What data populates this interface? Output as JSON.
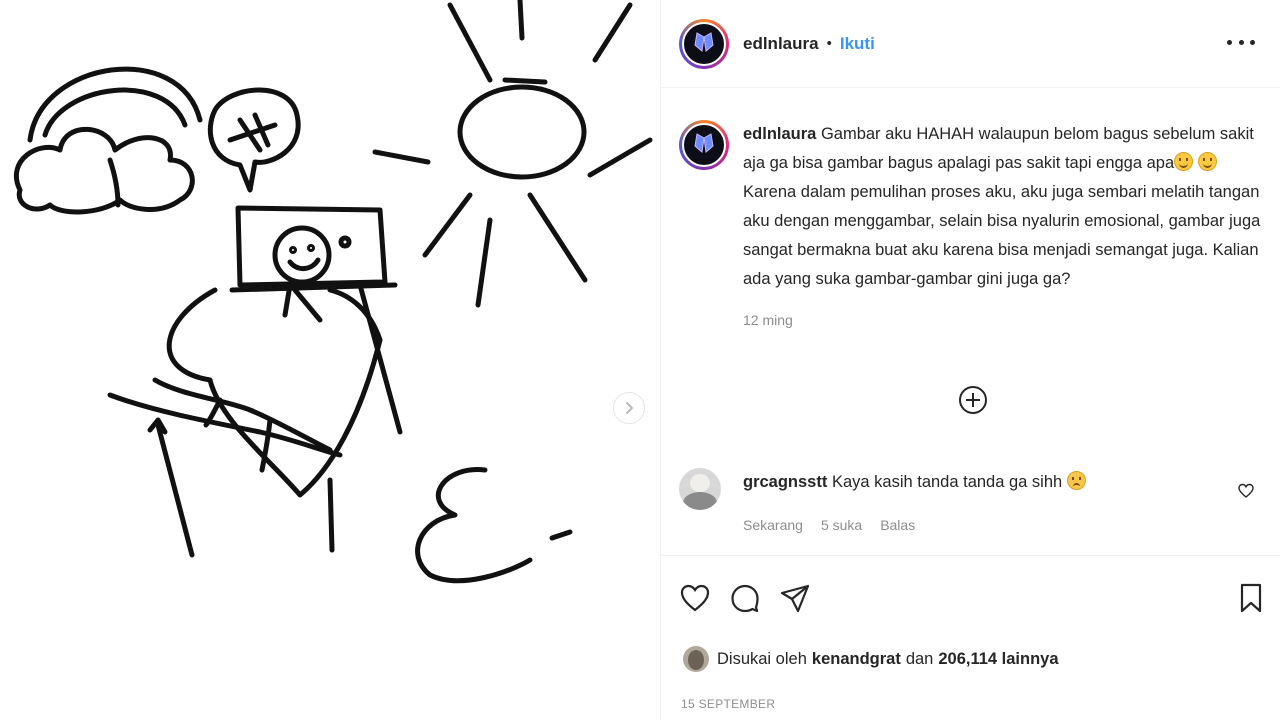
{
  "post": {
    "author": "edlnlaura",
    "separator": "•",
    "follow_label": "Ikuti",
    "more_options_icon": "more-horizontal-icon"
  },
  "caption": {
    "author": "edlnlaura",
    "text_part1": "Gambar aku HAHAH walaupun belom bagus sebelum sakit aja ga bisa gambar bagus apalagi pas sakit tapi engga apa",
    "text_part2": "Karena dalam pemulihan proses aku, aku juga sembari melatih tangan aku dengan menggambar, selain bisa nyalurin emosional, gambar juga sangat bermakna buat aku karena bisa menjadi semangat juga. Kalian ada yang suka gambar-gambar gini juga ga?",
    "time": "12 ming"
  },
  "load_more_icon": "plus-circle-icon",
  "comments": [
    {
      "author": "grcagnsstt",
      "text": "Kaya kasih tanda tanda ga sihh",
      "time": "Sekarang",
      "likes": "5 suka",
      "reply_label": "Balas"
    }
  ],
  "actions": {
    "like_icon": "heart-icon",
    "comment_icon": "comment-icon",
    "share_icon": "send-icon",
    "save_icon": "bookmark-icon"
  },
  "likes": {
    "prefix": "Disukai oleh",
    "user": "kenandgrat",
    "conjunction": "dan",
    "others": "206,114 lainnya"
  },
  "date": "15 SEPTEMBER",
  "colors": {
    "link": "#3897f0",
    "muted": "#8e8e8e",
    "text": "#262626",
    "border": "#efefef"
  }
}
